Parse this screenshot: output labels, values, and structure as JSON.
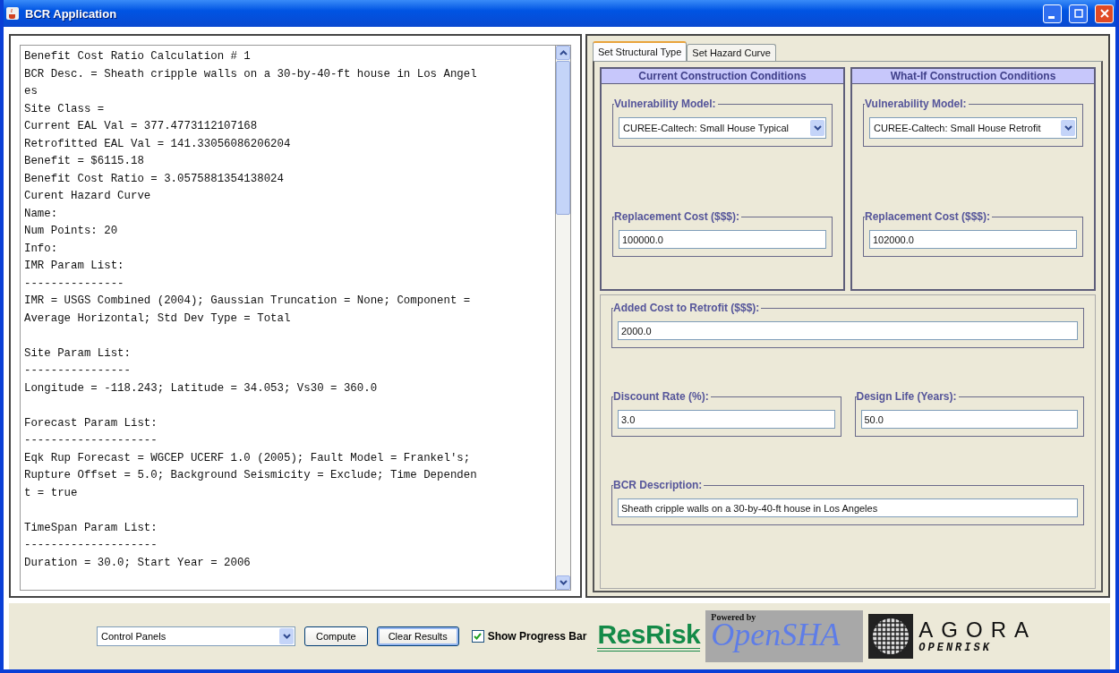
{
  "window": {
    "title": "BCR Application"
  },
  "output": {
    "lines": [
      {
        "text": "Benefit Cost Ratio Calculation # 1",
        "space_before": false
      },
      {
        "text": "BCR Desc. = Sheath cripple walls on a 30-by-40-ft house in Los Angel",
        "space_before": false
      },
      {
        "text": "es",
        "space_before": false
      },
      {
        "text": "Site Class =",
        "space_before": false
      },
      {
        "text": "Current EAL Val = 377.4773112107168",
        "space_before": false
      },
      {
        "text": "Retrofitted EAL Val = 141.33056086206204",
        "space_before": false
      },
      {
        "text": "Benefit = $6115.18",
        "space_before": false
      },
      {
        "text": "Benefit Cost Ratio = 3.0575881354138024",
        "space_before": false
      },
      {
        "text": "Curent Hazard Curve",
        "space_before": false
      },
      {
        "text": "Name:",
        "space_before": false
      },
      {
        "text": "Num Points: 20",
        "space_before": false
      },
      {
        "text": "Info:",
        "space_before": false
      },
      {
        "text": "IMR Param List:",
        "space_before": false
      },
      {
        "text": "---------------",
        "space_before": false
      },
      {
        "text": "IMR = USGS Combined (2004); Gaussian Truncation = None; Component =",
        "space_before": false
      },
      {
        "text": "Average Horizontal; Std Dev Type = Total",
        "space_before": false
      },
      {
        "text": "Site Param List:",
        "space_before": true
      },
      {
        "text": "----------------",
        "space_before": false
      },
      {
        "text": "Longitude = -118.243; Latitude = 34.053; Vs30 = 360.0",
        "space_before": false
      },
      {
        "text": "Forecast Param List:",
        "space_before": true
      },
      {
        "text": "--------------------",
        "space_before": false
      },
      {
        "text": "Eqk Rup Forecast = WGCEP UCERF 1.0 (2005); Fault Model = Frankel's;",
        "space_before": false
      },
      {
        "text": "Rupture Offset = 5.0; Background Seismicity = Exclude; Time Dependen",
        "space_before": false
      },
      {
        "text": "t = true",
        "space_before": false
      },
      {
        "text": "TimeSpan Param List:",
        "space_before": true
      },
      {
        "text": "--------------------",
        "space_before": false
      },
      {
        "text": "Duration = 30.0; Start Year = 2006",
        "space_before": false
      }
    ]
  },
  "tabs": [
    {
      "label": "Set Structural Type",
      "selected": true
    },
    {
      "label": "Set Hazard Curve",
      "selected": false
    }
  ],
  "conditions": [
    {
      "title": "Current Construction Conditions",
      "vulnerability_label": "Vulnerability Model:",
      "vulnerability_value": "CUREE-Caltech: Small House Typical",
      "cost_label": "Replacement Cost ($$$):",
      "cost_value": "100000.0"
    },
    {
      "title": "What-If Construction Conditions",
      "vulnerability_label": "Vulnerability Model:",
      "vulnerability_value": "CUREE-Caltech: Small House Retrofit",
      "cost_label": "Replacement Cost ($$$):",
      "cost_value": "102000.0"
    }
  ],
  "added_cost": {
    "label": "Added Cost to Retrofit ($$$):",
    "value": "2000.0"
  },
  "discount_rate": {
    "label": "Discount Rate (%):",
    "value": "3.0"
  },
  "design_life": {
    "label": "Design Life (Years):",
    "value": "50.0"
  },
  "bcr_description": {
    "label": "BCR Description:",
    "value": "Sheath cripple walls on a 30-by-40-ft house in Los Angeles"
  },
  "bottom_bar": {
    "panel_select": "Control Panels",
    "buttons": [
      {
        "label": "Compute",
        "focused": false
      },
      {
        "label": "Clear Results",
        "focused": true
      }
    ],
    "progress_checkbox": {
      "label": "Show Progress Bar",
      "checked": true
    },
    "logos": {
      "resrisk": "ResRisk",
      "powered_by": "Powered by",
      "opensha": "OpenSHA",
      "agora": "AGORA",
      "openrisk": "OPENRISK"
    }
  }
}
